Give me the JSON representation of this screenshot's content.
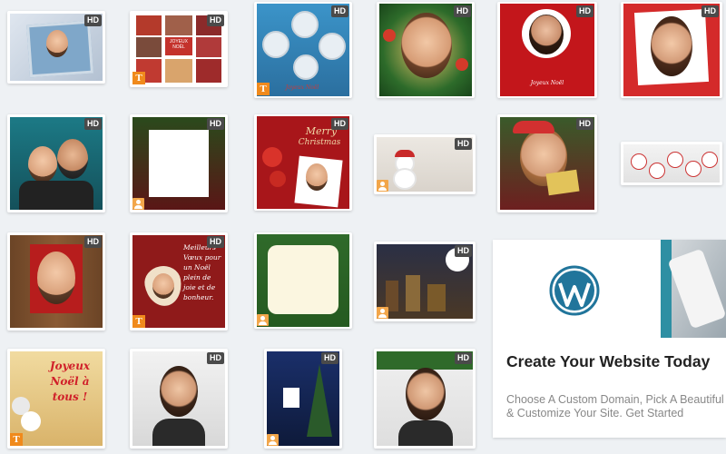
{
  "badges": {
    "hd": "HD",
    "tool": "T"
  },
  "cards": {
    "c2_text": "JOYEUX NOËL",
    "c3_text": "Joyeux Noël",
    "c5_text": "Joyeux Noël",
    "c9_line1": "Merry",
    "c9_line2": "Christmas",
    "c14_text": "Meilleurs Vœux pour un Noël plein de joie et de bonheur.",
    "c19_text": "Joyeux Noël à tous !"
  },
  "ad": {
    "logo": "wordpress-logo",
    "title": "Create Your Website Today",
    "description": "Choose A Custom Domain, Pick A Beautiful Design, & Customize Your Site. Get Started"
  },
  "colors": {
    "background": "#eef1f4",
    "hd_badge": "#4a4a4a",
    "tool_badge": "#f08a1c",
    "wordpress_blue": "#21759b"
  }
}
